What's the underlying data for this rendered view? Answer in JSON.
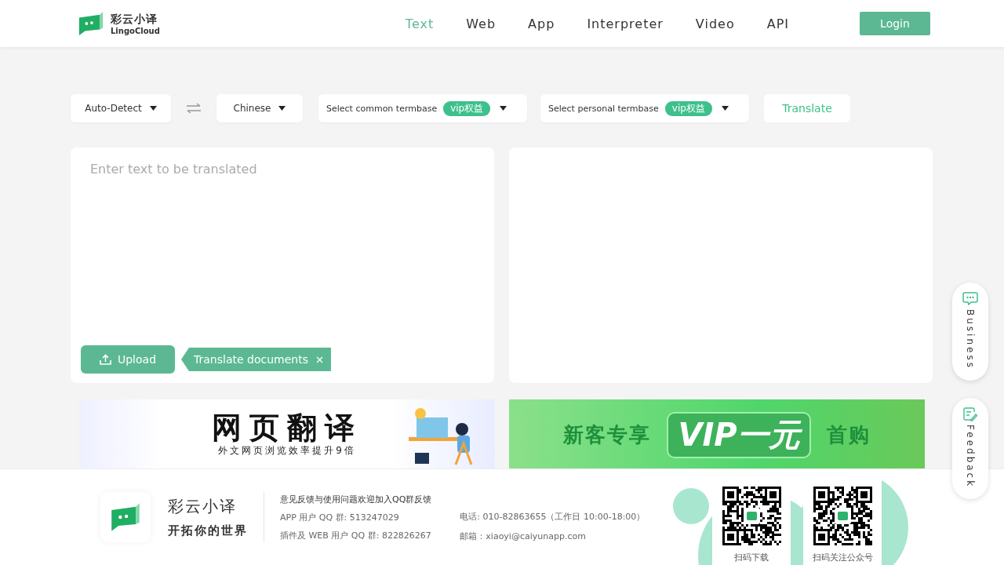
{
  "header": {
    "logo": {
      "name": "彩云小译",
      "subtitle": "LingoCloud"
    },
    "nav": [
      {
        "label": "Text",
        "selected": true
      },
      {
        "label": "Web",
        "selected": false
      },
      {
        "label": "App",
        "selected": false
      },
      {
        "label": "Interpreter",
        "selected": false
      },
      {
        "label": "Video",
        "selected": false
      },
      {
        "label": "API",
        "selected": false
      }
    ],
    "login": "Login"
  },
  "toolbar": {
    "source_language": "Auto-Detect",
    "target_language": "Chinese",
    "termbases": [
      {
        "label": "Select common termbase",
        "badge": "vip权益"
      },
      {
        "label": "Select personal termbase",
        "badge": "vip权益"
      }
    ],
    "translate": "Translate"
  },
  "input": {
    "placeholder": "Enter text to be translated",
    "upload": "Upload",
    "tip": "Translate documents"
  },
  "banners": [
    {
      "kind": "web",
      "title": "网页翻译",
      "subtitle": "外文网页浏览效率提升9倍"
    },
    {
      "kind": "vip",
      "left": "新客专享",
      "title": "VIP一元",
      "right": "首购"
    }
  ],
  "side_buttons": [
    {
      "kind": "chat",
      "label": "Business"
    },
    {
      "kind": "feedback",
      "label": "Feedback"
    }
  ],
  "footer": {
    "brand": "彩云小译",
    "slogan": "开拓你的世界",
    "lines": [
      "意见反馈与使用问题欢迎加入QQ群反馈",
      "APP 用户 QQ 群: 513247029",
      "插件及 WEB 用户 QQ 群: 822826267"
    ],
    "contacts": [
      "电话: 010-82863655（工作日 10:00-18:00）",
      "邮箱：xiaoyi@caiyunapp.com"
    ],
    "qr_codes": [
      {
        "caption": "扫码下载"
      },
      {
        "caption": "扫码关注公众号"
      }
    ]
  }
}
